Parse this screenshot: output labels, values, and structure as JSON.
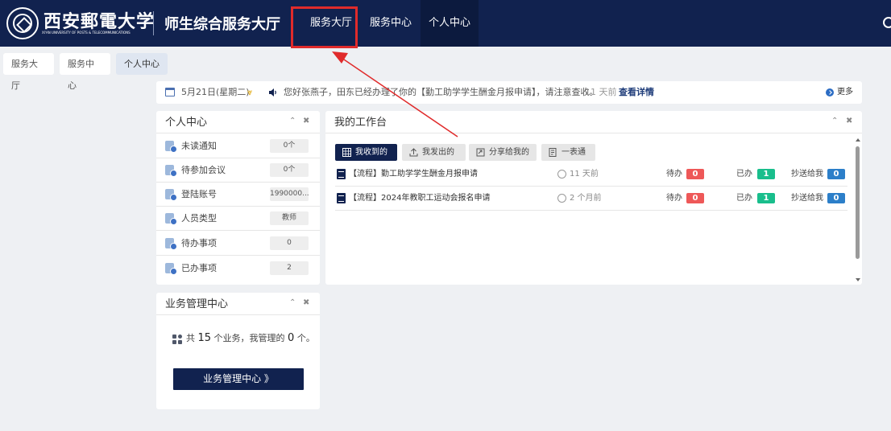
{
  "header": {
    "logo_text": "西安郵電大学",
    "logo_subtext": "XI'AN UNIVERSITY OF POSTS & TELECOMMUNICATIONS",
    "app_title": "师生综合服务大厅",
    "nav": [
      "服务大厅",
      "服务中心",
      "个人中心"
    ],
    "active_nav": "个人中心"
  },
  "breadcrumbs": [
    "服务大厅",
    "服务中心",
    "个人中心"
  ],
  "notice": {
    "date": "5月21日(星期二)",
    "message": "您好张燕子，田东已经办理了你的【勤工助学学生酬金月报申请】，请注意查收。",
    "time": "11 天前",
    "detail_link": "查看详情",
    "more_link": "更多"
  },
  "personal_center": {
    "title": "个人中心",
    "rows": [
      {
        "label": "未读通知",
        "value": "0个"
      },
      {
        "label": "待参加会议",
        "value": "0个"
      },
      {
        "label": "登陆账号",
        "value": "1990000..."
      },
      {
        "label": "人员类型",
        "value": "教师"
      },
      {
        "label": "待办事项",
        "value": "0"
      },
      {
        "label": "已办事项",
        "value": "2"
      }
    ]
  },
  "business_center": {
    "title": "业务管理中心",
    "text_prefix": "共",
    "total": "15",
    "text_middle": "个业务，我管理的",
    "managed": "0",
    "text_suffix": "个。",
    "button_label": "业务管理中心 》"
  },
  "workbench": {
    "title": "我的工作台",
    "tabs": [
      "我收到的",
      "我发出的",
      "分享给我的",
      "一表通"
    ],
    "active_tab": "我收到的",
    "items": [
      {
        "title": "【流程】勤工助学学生酬金月报申请",
        "time": "11 天前",
        "todo_label": "待办",
        "todo": "0",
        "done_label": "已办",
        "done": "1",
        "cc_label": "抄送给我",
        "cc": "0"
      },
      {
        "title": "【流程】2024年教职工运动会报名申请",
        "time": "2 个月前",
        "todo_label": "待办",
        "todo": "0",
        "done_label": "已办",
        "done": "1",
        "cc_label": "抄送给我",
        "cc": "0"
      }
    ]
  },
  "panel_controls": {
    "collapse": "⌃",
    "close": "✖"
  },
  "colors": {
    "navy": "#11224f",
    "annotation_red": "#e02b2b",
    "badge_red": "#ee5858",
    "badge_green": "#19be8c",
    "badge_blue": "#2c7fc9"
  }
}
